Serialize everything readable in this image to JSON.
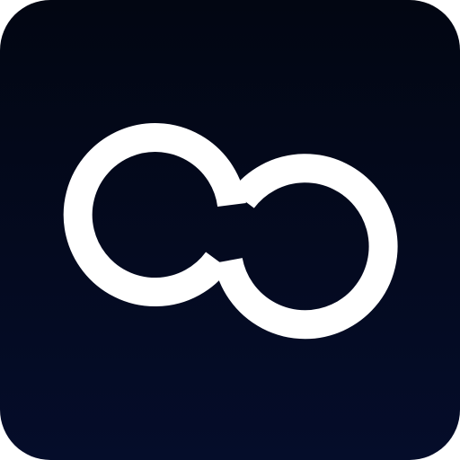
{
  "icon": {
    "name": "infinity-icon",
    "background_top": "#020612",
    "background_bottom": "#050d2a",
    "glyph_color": "#ffffff"
  }
}
